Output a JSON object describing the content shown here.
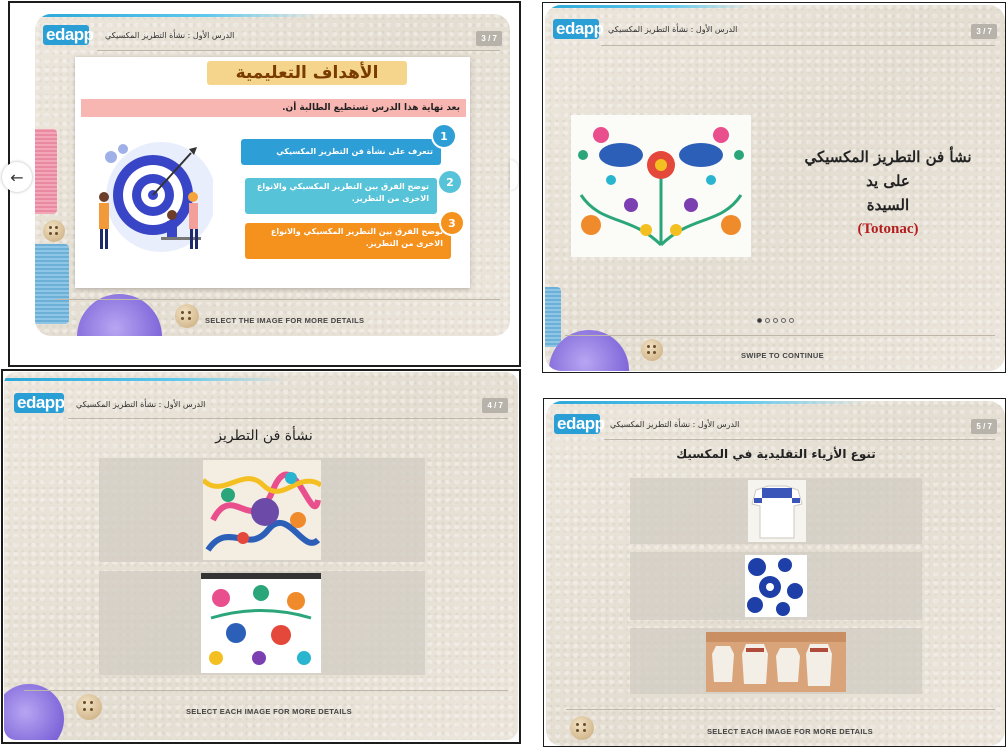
{
  "brand": {
    "logo_ed": "ed",
    "logo_app": "app",
    "accent": "#2a9fd6"
  },
  "breadcrumb": "الدرس الأول : نشأة التطريز المكسيكي",
  "slides": [
    {
      "page": "3 / 7",
      "title": "الأهداف التعليمية",
      "subtitle": "بعد نهاية هذا الدرس تستطيع الطالبة أن.",
      "goals": [
        {
          "num": "1",
          "text": "تتعرف على نشأة فن التطريز المكسيكي",
          "color": "#2e9ed6"
        },
        {
          "num": "2",
          "text": "توضح الفرق بين التطريز المكسيكي والانواع الاخرى من التطريز.",
          "color": "#57c3d8"
        },
        {
          "num": "3",
          "text": "توضح الفرق بين التطريز المكسيكي والانواع الاخرى من التطريز.",
          "color": "#f5921e"
        }
      ],
      "footer": "SELECT THE IMAGE FOR MORE DETAILS",
      "nav_back_icon": "arrow-left-icon"
    },
    {
      "page": "3 / 7",
      "heading_line1": "نشأ فن التطريز المكسيكي على يد",
      "heading_line2": "السيدة",
      "heading_accent": "(Totonac)",
      "footer": "SWIPE TO CONTINUE",
      "dots_total": 5,
      "dots_active": 0
    },
    {
      "page": "4 / 7",
      "heading": "نشأة فن التطريز",
      "footer": "SELECT EACH IMAGE FOR MORE DETAILS"
    },
    {
      "page": "5 / 7",
      "heading": "تنوع الأزياء التقليدية في المكسيك",
      "footer": "SELECT EACH IMAGE FOR MORE DETAILS"
    }
  ]
}
